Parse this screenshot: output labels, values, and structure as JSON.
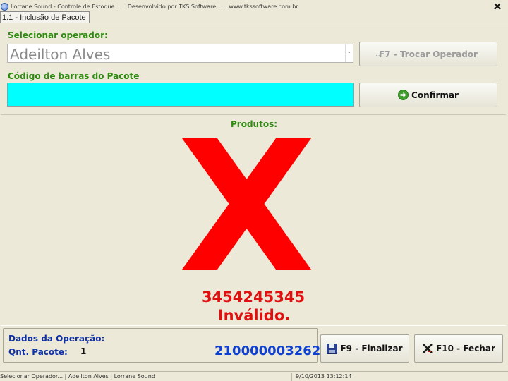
{
  "window": {
    "title": "Lorrane Sound - Controle de Estoque .:::. Desenvolvido por TKS Software .:::. www.tkssoftware.com.br",
    "close_icon": "close-x-icon",
    "app_icon": "app-globe-icon"
  },
  "tab": {
    "label": "1.1 - Inclusão de Pacote"
  },
  "operator": {
    "label": "Selecionar operador:",
    "selected": "Adeilton Alves",
    "dropdown_arrow": "-",
    "trocar_button": "F7 - Trocar Operador",
    "trocar_mark": ".."
  },
  "barcode": {
    "label": "Código de barras do Pacote",
    "value": "",
    "confirm_button": "Confirmar",
    "confirm_icon": "green-arrow-icon"
  },
  "products": {
    "label": "Produtos:",
    "error_icon": "big-red-x-icon",
    "code": "3454245345",
    "status": "Inválido."
  },
  "operation": {
    "label": "Dados da Operação:",
    "qnt_label": "Qnt. Pacote:",
    "qnt_value": "1",
    "order_number": "210000003262"
  },
  "buttons": {
    "finalizar": "F9 - Finalizar",
    "finalizar_icon": "floppy-disk-icon",
    "fechar": "F10 - Fechar",
    "fechar_icon": "close-x-icon"
  },
  "statusbar": {
    "left": "Selecionar Operador... | Adeilton Alves | Lorrane Sound",
    "right": "9/10/2013 13:12:14"
  },
  "colors": {
    "window_bg": "#ece9d8",
    "label_green": "#2f8a12",
    "label_blue": "#1030a8",
    "barcode_field": "#00ffff",
    "error_red": "#e01010",
    "order_blue": "#1040d0"
  }
}
